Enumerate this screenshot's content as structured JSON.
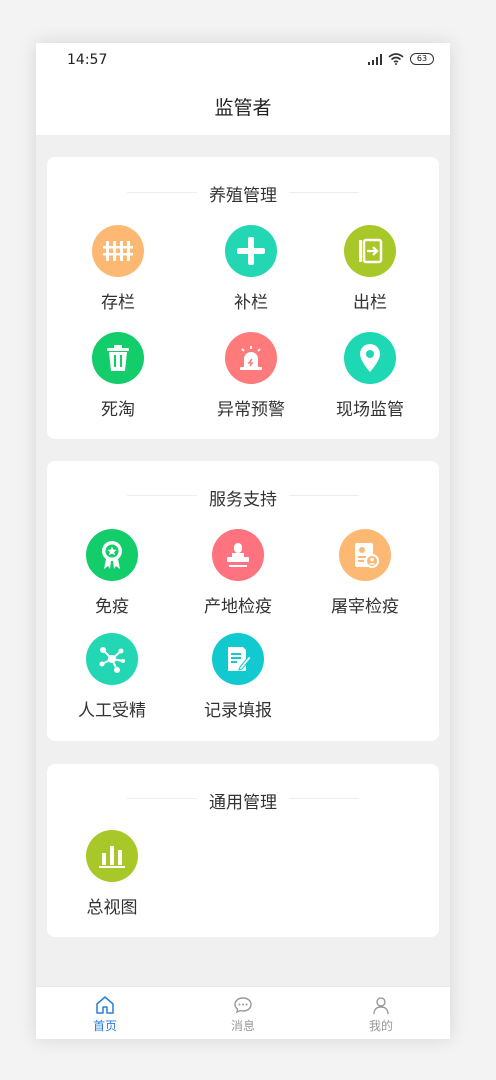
{
  "status_bar": {
    "time": "14:57",
    "battery": "63"
  },
  "header": {
    "title": "监管者"
  },
  "sections": [
    {
      "title": "养殖管理",
      "items": [
        {
          "label": "存栏",
          "icon": "fence-icon",
          "color": "#fdb873"
        },
        {
          "label": "补栏",
          "icon": "plus-icon",
          "color": "#23d7b4"
        },
        {
          "label": "出栏",
          "icon": "exit-box-icon",
          "color": "#a8c82a"
        },
        {
          "label": "死淘",
          "icon": "trash-icon",
          "color": "#12cd6a"
        },
        {
          "label": "异常预警",
          "icon": "alarm-icon",
          "color": "#ff7b7b"
        },
        {
          "label": "现场监管",
          "icon": "location-pin-icon",
          "color": "#1ed8b3"
        }
      ]
    },
    {
      "title": "服务支持",
      "items": [
        {
          "label": "免疫",
          "icon": "badge-icon",
          "color": "#12cd6a"
        },
        {
          "label": "产地检疫",
          "icon": "stamp-icon",
          "color": "#ff727f"
        },
        {
          "label": "屠宰检疫",
          "icon": "certificate-icon",
          "color": "#fdb873"
        },
        {
          "label": "人工受精",
          "icon": "molecule-icon",
          "color": "#23d7b4"
        },
        {
          "label": "记录填报",
          "icon": "edit-document-icon",
          "color": "#12c9cf"
        }
      ]
    },
    {
      "title": "通用管理",
      "items": [
        {
          "label": "总视图",
          "icon": "bar-chart-icon",
          "color": "#a8c82a"
        }
      ]
    }
  ],
  "tabbar": {
    "items": [
      {
        "label": "首页",
        "icon": "home-icon",
        "active": true
      },
      {
        "label": "消息",
        "icon": "message-icon",
        "active": false
      },
      {
        "label": "我的",
        "icon": "user-icon",
        "active": false
      }
    ],
    "active_color": "#2a7fd4",
    "inactive_color": "#999999"
  }
}
